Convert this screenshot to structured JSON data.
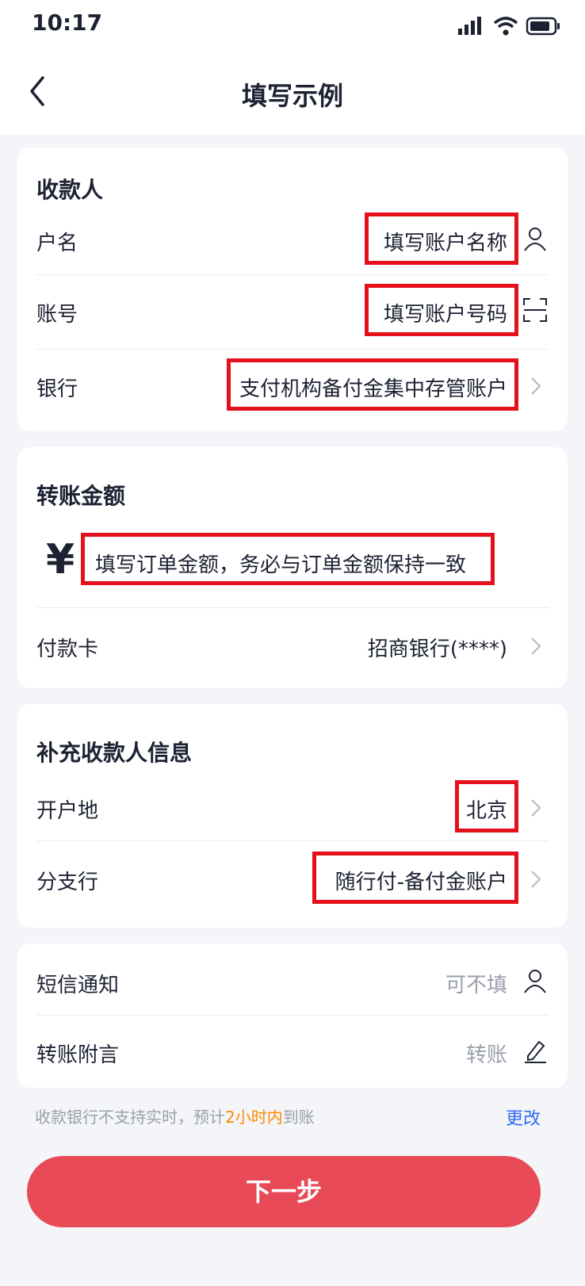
{
  "status": {
    "time": "10:17"
  },
  "nav": {
    "title": "填写示例"
  },
  "payee": {
    "title": "收款人",
    "name_label": "户名",
    "name_value": "填写账户名称",
    "account_label": "账号",
    "account_value": "填写账户号码",
    "bank_label": "银行",
    "bank_value": "支付机构备付金集中存管账户"
  },
  "amount": {
    "title": "转账金额",
    "symbol": "¥",
    "hint": "填写订单金额，务必与订单金额保持一致",
    "card_label": "付款卡",
    "card_value": "招商银行(****)"
  },
  "extra": {
    "title": "补充收款人信息",
    "location_label": "开户地",
    "location_value": "北京",
    "branch_label": "分支行",
    "branch_value": "随行付-备付金账户"
  },
  "notify": {
    "sms_label": "短信通知",
    "sms_placeholder": "可不填",
    "memo_label": "转账附言",
    "memo_placeholder": "转账"
  },
  "footer": {
    "note_prefix": "收款银行不支持实时，预计",
    "note_highlight": "2小时内",
    "note_suffix": "到账",
    "change_link": "更改"
  },
  "button": {
    "next": "下一步"
  },
  "colors": {
    "highlight": "#e4111c",
    "accent": "#2d6bf0",
    "button": "#e84a57",
    "note_highlight": "#ff8a00"
  },
  "icons": [
    "signal-icon",
    "wifi-icon",
    "battery-icon",
    "back-arrow-icon",
    "person-icon",
    "scan-icon",
    "chevron-right-icon",
    "edit-icon"
  ]
}
